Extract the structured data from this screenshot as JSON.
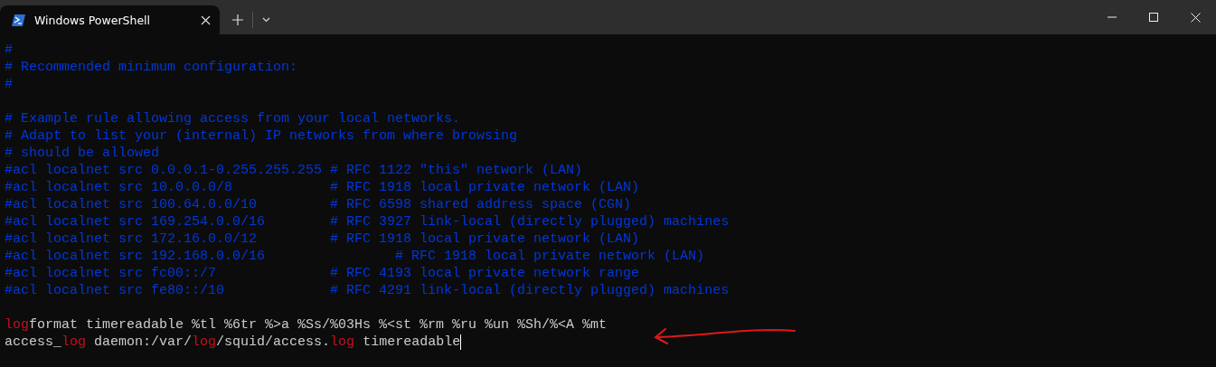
{
  "window": {
    "tab": {
      "title": "Windows PowerShell",
      "selected": true
    }
  },
  "terminal": {
    "lines": [
      {
        "segments": [
          {
            "kind": "comment",
            "text": "#"
          }
        ]
      },
      {
        "segments": [
          {
            "kind": "comment",
            "text": "# Recommended minimum configuration:"
          }
        ]
      },
      {
        "segments": [
          {
            "kind": "comment",
            "text": "#"
          }
        ]
      },
      {
        "kind": "blank"
      },
      {
        "segments": [
          {
            "kind": "comment",
            "text": "# Example rule allowing access from your local networks."
          }
        ]
      },
      {
        "segments": [
          {
            "kind": "comment",
            "text": "# Adapt to list your (internal) IP networks from where browsing"
          }
        ]
      },
      {
        "segments": [
          {
            "kind": "comment",
            "text": "# should be allowed"
          }
        ]
      },
      {
        "segments": [
          {
            "kind": "comment",
            "text": "#acl localnet src 0.0.0.1-0.255.255.255 # RFC 1122 \"this\" network (LAN)"
          }
        ]
      },
      {
        "segments": [
          {
            "kind": "comment",
            "text": "#acl localnet src 10.0.0.0/8            # RFC 1918 local private network (LAN)"
          }
        ]
      },
      {
        "segments": [
          {
            "kind": "comment",
            "text": "#acl localnet src 100.64.0.0/10         # RFC 6598 shared address space (CGN)"
          }
        ]
      },
      {
        "segments": [
          {
            "kind": "comment",
            "text": "#acl localnet src 169.254.0.0/16        # RFC 3927 link-local (directly plugged) machines"
          }
        ]
      },
      {
        "segments": [
          {
            "kind": "comment",
            "text": "#acl localnet src 172.16.0.0/12         # RFC 1918 local private network (LAN)"
          }
        ]
      },
      {
        "segments": [
          {
            "kind": "comment",
            "text": "#acl localnet src 192.168.0.0/16                # RFC 1918 local private network (LAN)"
          }
        ]
      },
      {
        "segments": [
          {
            "kind": "comment",
            "text": "#acl localnet src fc00::/7              # RFC 4193 local private network range"
          }
        ]
      },
      {
        "segments": [
          {
            "kind": "comment",
            "text": "#acl localnet src fe80::/10             # RFC 4291 link-local (directly plugged) machines"
          }
        ]
      },
      {
        "kind": "blank"
      },
      {
        "segments": [
          {
            "kind": "match",
            "text": "log"
          },
          {
            "kind": "plain",
            "text": "format timereadable %tl %6tr %>a %Ss/%03Hs %<st %rm %ru %un %Sh/%<A %mt"
          }
        ]
      },
      {
        "segments": [
          {
            "kind": "plain",
            "text": "access_"
          },
          {
            "kind": "match",
            "text": "log"
          },
          {
            "kind": "plain",
            "text": " daemon:/var/"
          },
          {
            "kind": "match",
            "text": "log"
          },
          {
            "kind": "plain",
            "text": "/squid/access."
          },
          {
            "kind": "match",
            "text": "log"
          },
          {
            "kind": "plain",
            "text": " timereadable"
          }
        ],
        "cursor": true
      }
    ],
    "annotation": {
      "kind": "arrow"
    }
  }
}
